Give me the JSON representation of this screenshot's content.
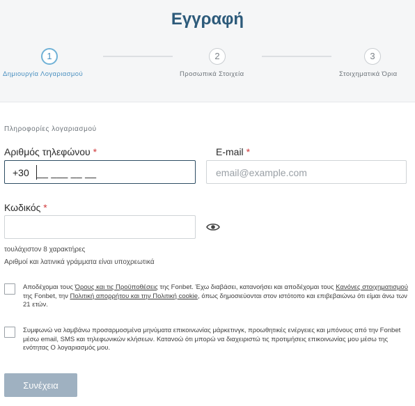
{
  "page": {
    "title": "Εγγραφή"
  },
  "steps": [
    {
      "number": "1",
      "label": "Δημιουργία Λογαριασμού",
      "active": true
    },
    {
      "number": "2",
      "label": "Προσωπικά Στοιχεία",
      "active": false
    },
    {
      "number": "3",
      "label": "Στοιχηματικά Όρια",
      "active": false
    }
  ],
  "form": {
    "section_title": "Πληροφορίες λογαριασμού",
    "phone": {
      "label": "Αριθμός τηλεφώνου",
      "required_mark": "*",
      "prefix": "+30",
      "mask": "__ ___ __ __"
    },
    "email": {
      "label": "E-mail",
      "required_mark": "*",
      "placeholder": "email@example.com"
    },
    "password": {
      "label": "Κωδικός",
      "required_mark": "*",
      "value": ""
    },
    "password_hints": [
      "τουλάχιστον 8 χαρακτήρες",
      "Αριθμοί και λατινικά γράμματα είναι υποχρεωτικά"
    ]
  },
  "consents": {
    "terms": {
      "t1": "Αποδέχομαι τους ",
      "link1": "Όρους και τις Προϋποθέσεις",
      "t2": " της Fonbet. Έχω διαβάσει, κατανοήσει και αποδέχομαι τους ",
      "link2": "Κανόνες στοιχηματισμού",
      "t3": " της Fonbet, την ",
      "link3": "Πολιτική απορρήτου και την Πολιτική cookie",
      "t4": ", όπως δημοσιεύονται στον ιστότοπο και επιβεβαιώνω ότι είμαι άνω των 21 ετών."
    },
    "marketing": "Συμφωνώ να λαμβάνω προσαρμοσμένα μηνύματα επικοινωνίας μάρκετινγκ, προωθητικές ενέργειες και μπόνους από την Fonbet μέσω email, SMS και τηλεφωνικών κλήσεων. Κατανοώ ότι μπορώ να διαχειριστώ τις προτιμήσεις επικοινωνίας μου μέσω της ενότητας Ο λογαριασμός μου."
  },
  "actions": {
    "submit_label": "Συνέχεια"
  },
  "colors": {
    "title": "#2c5a7a",
    "active_step": "#4a90c0",
    "required": "#d0393b",
    "submit_bg": "#9fb1c1"
  }
}
